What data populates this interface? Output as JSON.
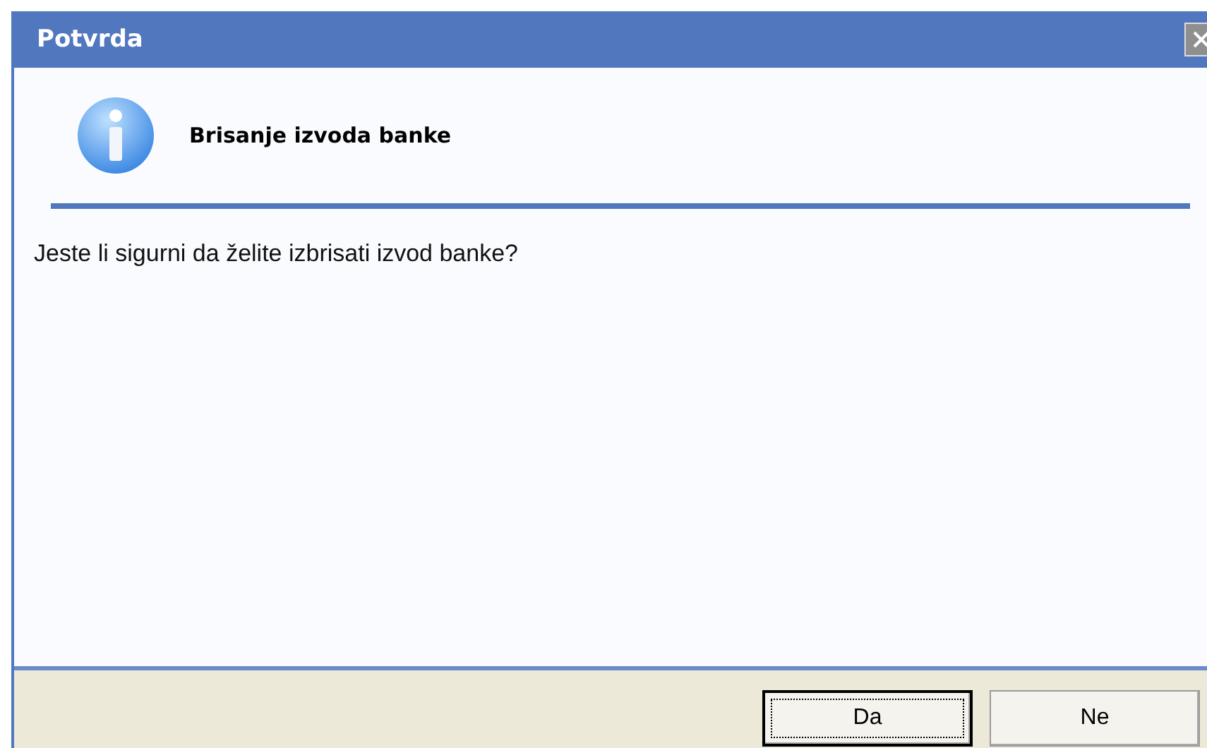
{
  "window": {
    "title": "Potvrda"
  },
  "header": {
    "title": "Brisanje izvoda banke"
  },
  "message": "Jeste li sigurni da želite izbrisati izvod banke?",
  "buttons": [
    {
      "label": "Da",
      "selected": true
    },
    {
      "label": "Ne",
      "selected": false
    }
  ]
}
